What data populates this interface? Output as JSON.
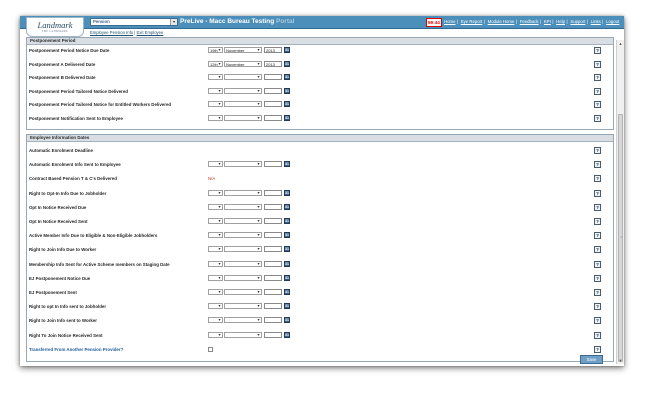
{
  "header": {
    "logo_text": "Landmark",
    "logo_small": "THE LANDMARK",
    "scheme_select": "Pension",
    "env_title": "PreLive - Macc Bureau Testing",
    "env_suffix": "Portal",
    "clock": "59:44",
    "links": [
      "Home",
      "Eye Report",
      "Module Home",
      "Feedback",
      "KPI",
      "Help",
      "Support",
      "Links",
      "Logout"
    ],
    "subnav": [
      "Employee Pension Info",
      "Exit Employee"
    ]
  },
  "postponement": {
    "title": "Postponement Period",
    "rows": [
      {
        "label": "Postponement Period Notice Due Date",
        "day": "19th",
        "month": "November",
        "year": "2013"
      },
      {
        "label": "Postponement A Delivered Date",
        "day": "12th",
        "month": "November",
        "year": "2013"
      },
      {
        "label": "Postponement B Delivered Date",
        "day": "",
        "month": "",
        "year": ""
      },
      {
        "label": "Postponement Period Tailored Notice Delivered",
        "day": "",
        "month": "",
        "year": ""
      },
      {
        "label": "Postponement Period Tailored Notice for Entitled Workers Delivered",
        "day": "",
        "month": "",
        "year": ""
      },
      {
        "label": "Postponement Notification Sent to Employee",
        "day": "",
        "month": "",
        "year": ""
      }
    ]
  },
  "employee_info": {
    "title": "Employee Information Dates",
    "rows": [
      {
        "label": "Automatic Enrolment Deadline"
      },
      {
        "label": "Automatic Enrolment Info Sent to Employee"
      },
      {
        "label": "Contract Based Pension T & C's Delivered",
        "value": "N/A"
      },
      {
        "label": "Right to Opt-In Info Due to Jobholder"
      },
      {
        "label": "Opt In Notice Received Due"
      },
      {
        "label": "Opt In Notice Received Sent"
      },
      {
        "label": "Active Member Info Due to Eligible & Non-Eligible Jobholders"
      },
      {
        "label": "Right to Join Info Due to Worker"
      },
      {
        "label": "Membership Info Sent for Active Scheme members on Staging Date"
      },
      {
        "label": "EJ Postponement Notice Due"
      },
      {
        "label": "EJ Postponement Sent"
      },
      {
        "label": "Right to opt In Info sent to Jobholder"
      },
      {
        "label": "Right to Join Info sent to Worker"
      },
      {
        "label": "Right To Join Notice Received Sent"
      },
      {
        "label": "Transferred From Another Pension Provider?"
      }
    ]
  },
  "help_glyph": "?",
  "calendar_glyph": "31",
  "save_label": "Save"
}
